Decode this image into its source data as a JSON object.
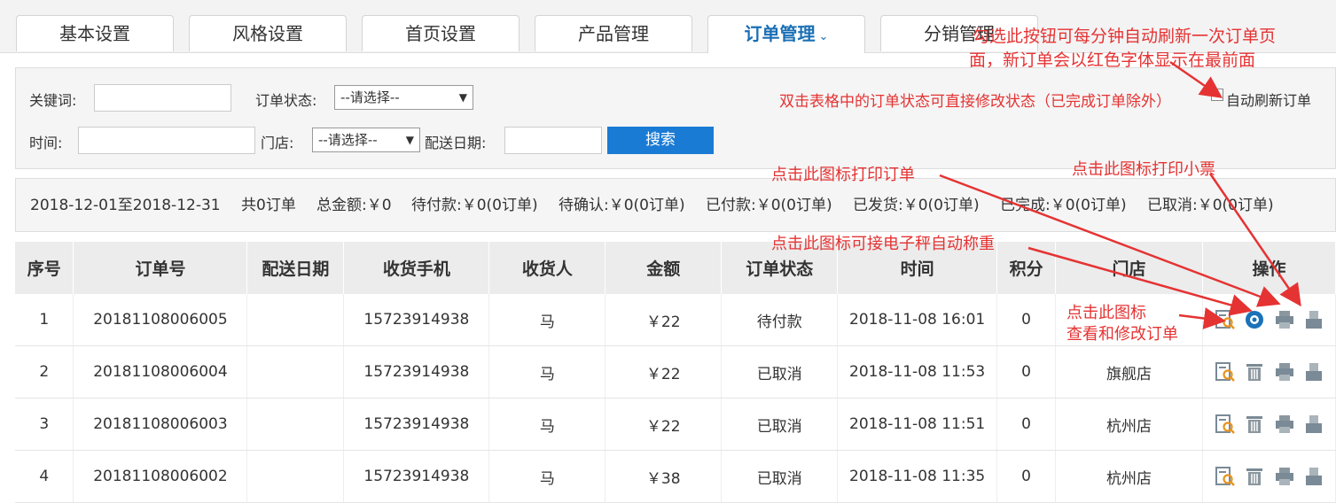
{
  "tabs": [
    {
      "label": "基本设置"
    },
    {
      "label": "风格设置"
    },
    {
      "label": "首页设置"
    },
    {
      "label": "产品管理"
    },
    {
      "label": "订单管理"
    },
    {
      "label": "分销管理"
    }
  ],
  "filter": {
    "keyword_label": "关键词:",
    "status_label": "订单状态:",
    "status_value": "--请选择--",
    "time_label": "时间:",
    "store_label": "门店:",
    "store_value": "--请选择--",
    "delivery_label": "配送日期:",
    "search_button": "搜索",
    "auto_refresh_label": "自动刷新订单",
    "auto_refresh_checked": false
  },
  "stats": {
    "range": "2018-12-01至2018-12-31",
    "count": "共0订单",
    "total": "总金额:￥0",
    "pending_pay": "待付款:￥0(0订单)",
    "pending_confirm": "待确认:￥0(0订单)",
    "paid": "已付款:￥0(0订单)",
    "shipped": "已发货:￥0(0订单)",
    "done": "已完成:￥0(0订单)",
    "cancelled": "已取消:￥0(0订单)"
  },
  "table": {
    "headers": [
      "序号",
      "订单号",
      "配送日期",
      "收货手机",
      "收货人",
      "金额",
      "订单状态",
      "时间",
      "积分",
      "门店",
      "操作"
    ],
    "rows": [
      {
        "no": "1",
        "order": "20181108006005",
        "delivery": "",
        "phone": "15723914938",
        "name": "马",
        "amount": "￥22",
        "status": "待付款",
        "time": "2018-11-08 16:01",
        "points": "0",
        "store": ""
      },
      {
        "no": "2",
        "order": "20181108006004",
        "delivery": "",
        "phone": "15723914938",
        "name": "马",
        "amount": "￥22",
        "status": "已取消",
        "time": "2018-11-08 11:53",
        "points": "0",
        "store": "旗舰店"
      },
      {
        "no": "3",
        "order": "20181108006003",
        "delivery": "",
        "phone": "15723914938",
        "name": "马",
        "amount": "￥22",
        "status": "已取消",
        "time": "2018-11-08 11:51",
        "points": "0",
        "store": "杭州店"
      },
      {
        "no": "4",
        "order": "20181108006002",
        "delivery": "",
        "phone": "15723914938",
        "name": "马",
        "amount": "￥38",
        "status": "已取消",
        "time": "2018-11-08 11:35",
        "points": "0",
        "store": "杭州店"
      }
    ]
  },
  "annotations": {
    "auto_refresh_1": "勾选此按钮可每分钟自动刷新一次订单页",
    "auto_refresh_2": "面，新订单会以红色字体显示在最前面",
    "dblclick": "双击表格中的订单状态可直接修改状态（已完成订单除外）",
    "print_order": "点击此图标打印订单",
    "print_ticket": "点击此图标打印小票",
    "scale": "点击此图标可接电子秤自动称重",
    "view_1": "点击此图标",
    "view_2": "查看和修改订单"
  },
  "colors": {
    "accent": "#1a7bd4",
    "annotation": "#e53333",
    "tab_active": "#1a6fb5"
  }
}
